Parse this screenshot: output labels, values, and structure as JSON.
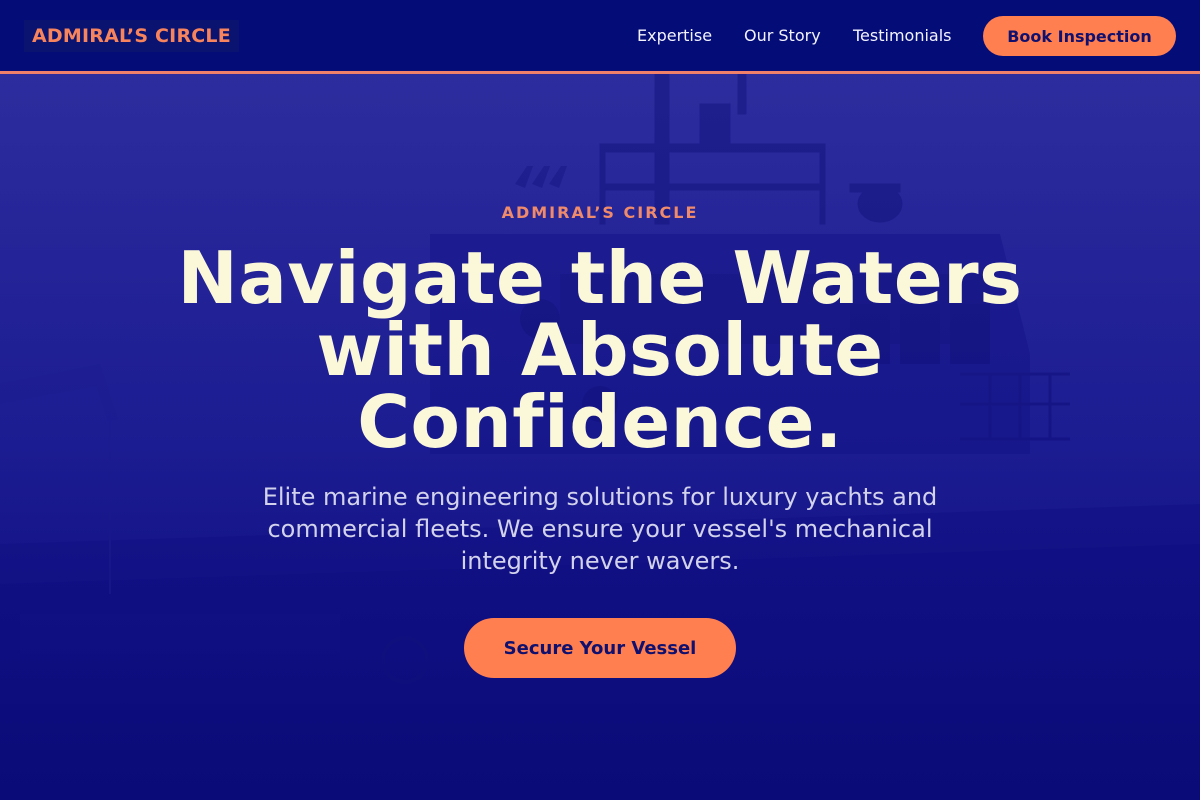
{
  "brand": {
    "logo_text": "ADMIRAL’S CIRCLE"
  },
  "nav": {
    "links": [
      {
        "label": "Expertise"
      },
      {
        "label": "Our Story"
      },
      {
        "label": "Testimonials"
      }
    ],
    "cta_label": "Book Inspection"
  },
  "hero": {
    "eyebrow": "ADMIRAL’S CIRCLE",
    "headline": "Navigate the Waters with Absolute Confidence.",
    "subtext": "Elite marine engineering solutions for luxury yachts and commercial fleets. We ensure your vessel's mechanical integrity never wavers.",
    "cta_label": "Secure Your Vessel",
    "background_image": "ship-photo"
  },
  "colors": {
    "nav_background": "#040c78",
    "accent": "#ff7f50",
    "hero_overlay": "#1a1a96",
    "headline_text": "#fbf8d9"
  }
}
